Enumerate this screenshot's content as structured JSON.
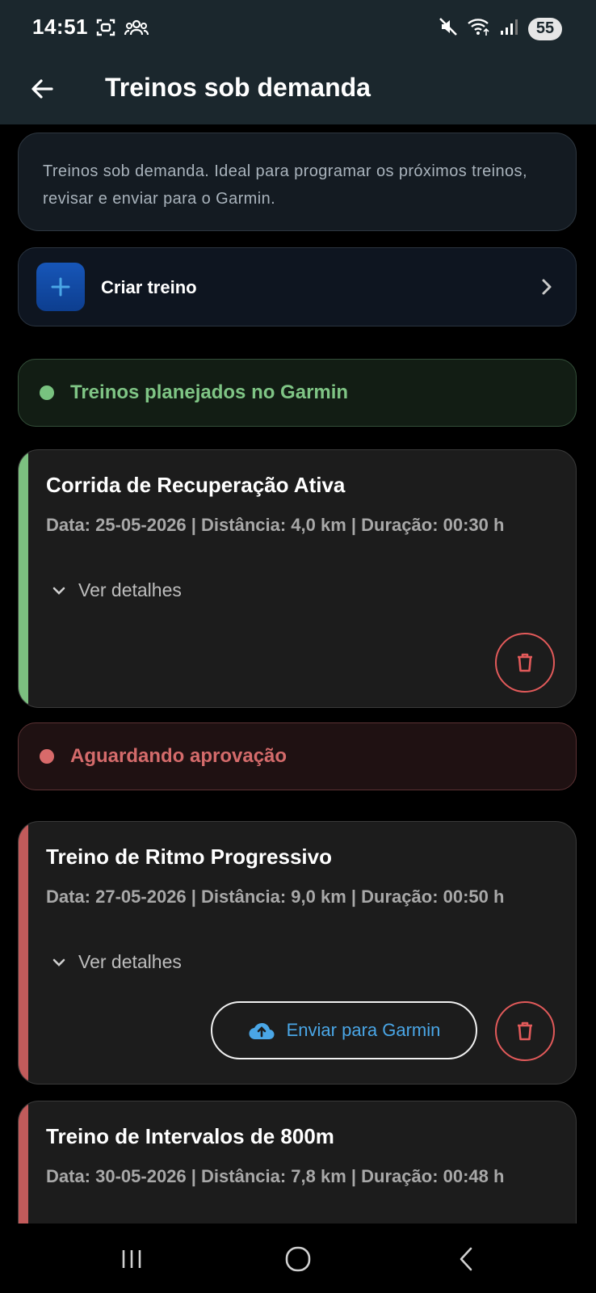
{
  "status_bar": {
    "time": "14:51",
    "battery": "55",
    "icons_left": [
      "screenshot-icon",
      "contacts-icon"
    ],
    "icons_right": [
      "mute-icon",
      "wifi-icon",
      "signal-icon"
    ]
  },
  "app_bar": {
    "title": "Treinos sob demanda",
    "back_icon": "back-arrow-icon"
  },
  "info_text": "Treinos sob demanda. Ideal para programar os próximos treinos, revisar e enviar para o Garmin.",
  "create": {
    "label": "Criar treino",
    "icon": "plus-icon"
  },
  "sections": {
    "planned": {
      "label": "Treinos planejados no Garmin",
      "color": "#7fc585"
    },
    "pending": {
      "label": "Aguardando aprovação",
      "color": "#d46b6b"
    }
  },
  "workouts": [
    {
      "title": "Corrida de Recuperação Ativa",
      "meta": "Data: 25-05-2026 | Distância: 4,0 km | Duração: 00:30 h",
      "details_label": "Ver detalhes",
      "status": "planned"
    },
    {
      "title": "Treino de Ritmo Progressivo",
      "meta": "Data: 27-05-2026 | Distância: 9,0 km | Duração: 00:50 h",
      "details_label": "Ver detalhes",
      "send_label": "Enviar para Garmin",
      "status": "pending"
    },
    {
      "title": "Treino de Intervalos de 800m",
      "meta": "Data: 30-05-2026 | Distância: 7,8 km | Duração: 00:48 h",
      "status": "pending"
    }
  ],
  "colors": {
    "accent_blue": "#4aa6e6",
    "delete_red": "#e25a5a",
    "appbar_bg": "#1b272d"
  }
}
